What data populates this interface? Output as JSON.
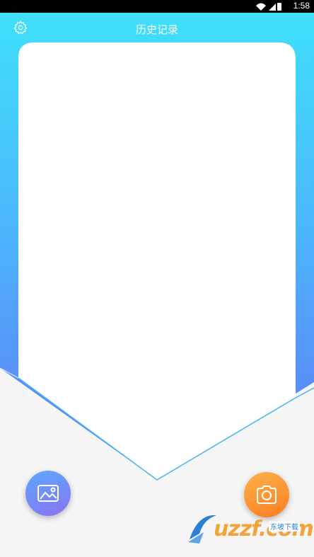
{
  "status_bar": {
    "time": "1:58"
  },
  "header": {
    "title": "历史记录"
  },
  "watermark": {
    "text": "uzzf.com",
    "subtitle": "东坡下载"
  },
  "colors": {
    "gradient_top": "#3fe0fa",
    "gradient_bottom": "#5f80f6",
    "gallery_button": "#7a8ff5",
    "camera_button": "#fb9333",
    "outline": "#44b5f0"
  },
  "icons": {
    "settings": "gear-icon",
    "gallery": "image-icon",
    "camera": "camera-icon"
  }
}
